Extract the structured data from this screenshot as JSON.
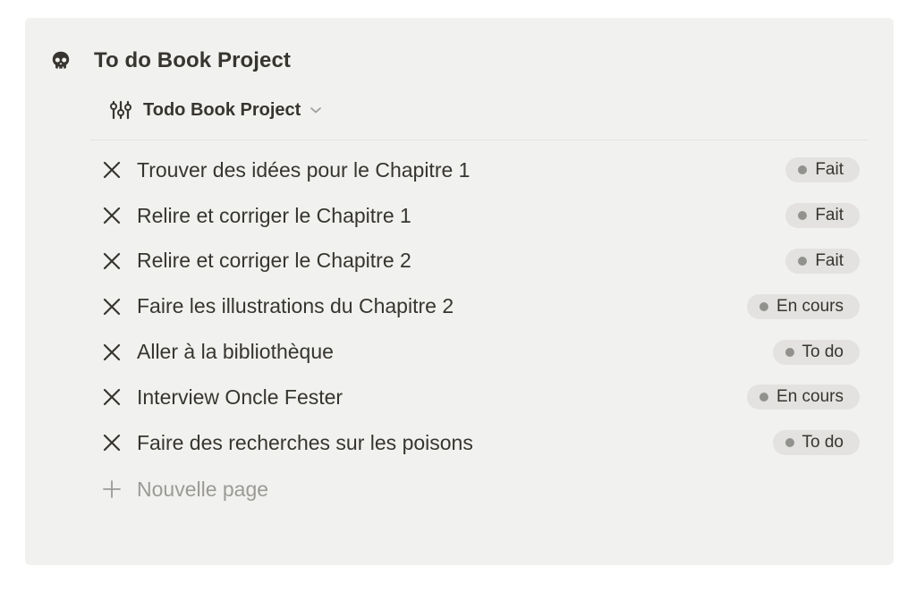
{
  "page": {
    "title": "To do Book Project",
    "icon": "skull-icon"
  },
  "view": {
    "label": "Todo Book Project",
    "icon": "sliders-icon",
    "dropdown_icon": "chevron-down-icon"
  },
  "tasks": [
    {
      "title": "Trouver des idées pour le Chapitre 1",
      "status": "Fait",
      "icon": "cross-icon"
    },
    {
      "title": "Relire et corriger le Chapitre 1",
      "status": "Fait",
      "icon": "cross-icon"
    },
    {
      "title": "Relire et corriger le Chapitre 2",
      "status": "Fait",
      "icon": "cross-icon"
    },
    {
      "title": "Faire les illustrations du Chapitre 2",
      "status": "En cours",
      "icon": "cross-icon"
    },
    {
      "title": "Aller à la bibliothèque",
      "status": "To do",
      "icon": "cross-icon"
    },
    {
      "title": "Interview Oncle Fester",
      "status": "En cours",
      "icon": "cross-icon"
    },
    {
      "title": "Faire des recherches sur les poisons",
      "status": "To do",
      "icon": "cross-icon"
    }
  ],
  "new_page": {
    "label": "Nouvelle page",
    "icon": "plus-icon"
  },
  "colors": {
    "panel_bg": "#f1f1ef",
    "text": "#37352f",
    "badge_bg": "#e3e2e0",
    "badge_dot": "#91918e",
    "muted": "#9b9a97"
  }
}
